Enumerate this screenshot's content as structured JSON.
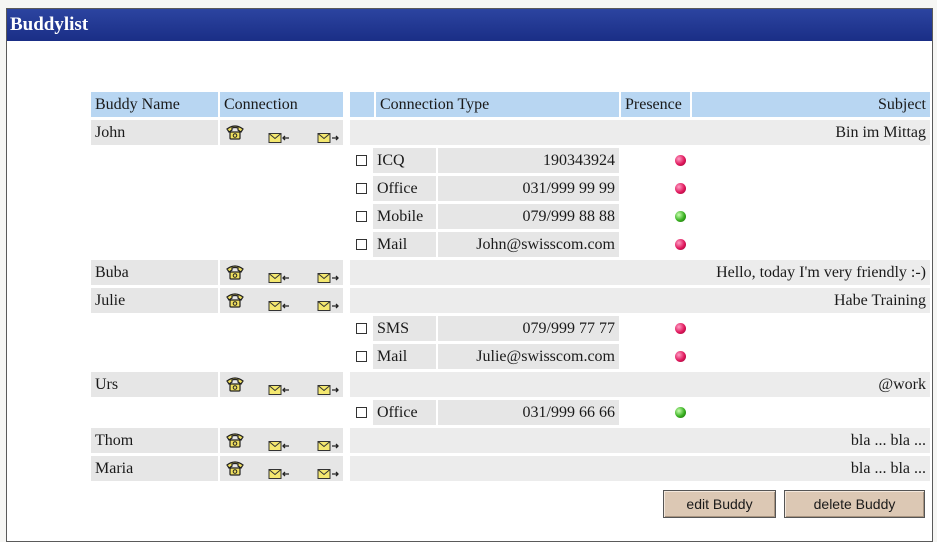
{
  "window": {
    "title": "Buddylist"
  },
  "headers": {
    "buddy_name": "Buddy Name",
    "connection": "Connection",
    "connection_type": "Connection Type",
    "presence": "Presence",
    "subject": "Subject"
  },
  "icons": {
    "phone": "telephone-icon",
    "mail_in": "incoming-mail-icon",
    "mail_out": "outgoing-mail-icon"
  },
  "colors": {
    "title_bar": "#1a2e86",
    "header_bg": "#b8d6f2",
    "presence_offline": "#e0185c",
    "presence_online": "#38b020"
  },
  "buddies": [
    {
      "name": "John",
      "subject": "Bin im Mittag",
      "connections": [
        {
          "type": "ICQ",
          "value": "190343924",
          "presence": "red"
        },
        {
          "type": "Office",
          "value": "031/999 99 99",
          "presence": "red"
        },
        {
          "type": "Mobile",
          "value": "079/999 88 88",
          "presence": "green"
        },
        {
          "type": "Mail",
          "value": "John@swisscom.com",
          "presence": "red"
        }
      ]
    },
    {
      "name": "Buba",
      "subject": "Hello, today I'm very friendly :-)",
      "connections": []
    },
    {
      "name": "Julie",
      "subject": "Habe Training",
      "connections": [
        {
          "type": "SMS",
          "value": "079/999 77 77",
          "presence": "red"
        },
        {
          "type": "Mail",
          "value": "Julie@swisscom.com",
          "presence": "red"
        }
      ]
    },
    {
      "name": "Urs",
      "subject": "@work",
      "connections": [
        {
          "type": "Office",
          "value": "031/999 66 66",
          "presence": "green"
        }
      ]
    },
    {
      "name": "Thom",
      "subject": "bla ... bla ...",
      "connections": []
    },
    {
      "name": "Maria",
      "subject": "bla ... bla ...",
      "connections": []
    }
  ],
  "buttons": {
    "edit": "edit Buddy",
    "delete": "delete Buddy"
  }
}
